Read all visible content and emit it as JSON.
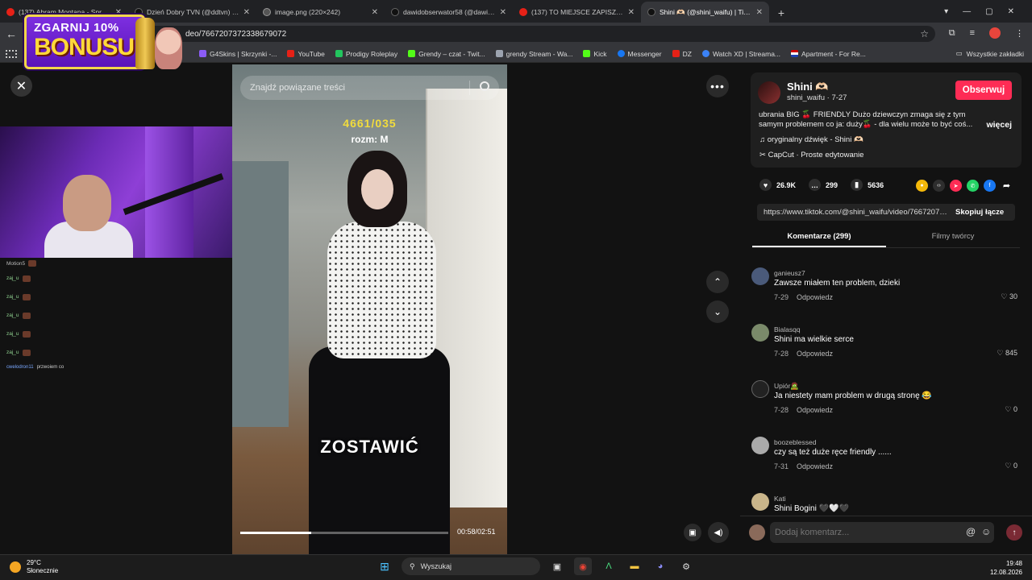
{
  "browser": {
    "tabs": [
      {
        "title": "(137) Abram Montana - Sprawi...",
        "favicon": "youtube-icon",
        "active": false
      },
      {
        "title": "Dzień Dobry TVN (@ddtvn) | Ti...",
        "favicon": "tiktok-icon",
        "active": false
      },
      {
        "title": "image.png (220×242)",
        "favicon": "globe-icon",
        "active": false
      },
      {
        "title": "dawidobserwator58 (@dawidob...",
        "favicon": "tiktok-icon",
        "active": false
      },
      {
        "title": "(137) TO MIEJSCE ZAPISZE SIĘ W...",
        "favicon": "youtube-icon",
        "active": false
      },
      {
        "title": "Shini 🫶🏻 (@shini_waifu) | TikT...",
        "favicon": "tiktok-icon",
        "active": true
      }
    ],
    "url_visible": "deo/7667207372338679072",
    "bookmarks": [
      {
        "label": "G4Skins | Skrzynki -...",
        "color": "#8b5cf6"
      },
      {
        "label": "YouTube",
        "color": "#e62117"
      },
      {
        "label": "Prodigy Roleplay",
        "color": "#22c55e"
      },
      {
        "label": "Grendy – czat - Twit...",
        "color": "#53fc18"
      },
      {
        "label": "grendy Stream - Wa...",
        "color": "#9ca3af"
      },
      {
        "label": "Kick",
        "color": "#53fc18"
      },
      {
        "label": "Messenger",
        "color": "#1877f2"
      },
      {
        "label": "DZ",
        "color": "#e62117"
      },
      {
        "label": "Watch XD | Streama...",
        "color": "#3b82f6"
      },
      {
        "label": "Apartment - For Re...",
        "color": "#1e40af"
      }
    ],
    "all_bookmarks": "Wszystkie zakładki",
    "new_tab": "+"
  },
  "overlay": {
    "bonus_line1": "ZGARNIJ 10%",
    "bonus_line2": "BONUSU",
    "chat_header": "Motion5",
    "chat_lines": [
      "zaj_u",
      "zaj_u",
      "zaj_u",
      "zaj_u",
      "zaj_u"
    ],
    "chat_last_user": "cwelodron11",
    "chat_last_text": "przwoiem co"
  },
  "video": {
    "search_placeholder": "Znajdź powiązane treści",
    "caption_count": "4661/035",
    "caption_size": "rozm: M",
    "caption_big": "ZOSTAWIĆ",
    "time": "00:58/02:51",
    "progress": 0.34
  },
  "post": {
    "author_name": "Shini 🫶🏻",
    "author_handle": "shini_waifu · 7-27",
    "follow": "Obserwuj",
    "description": "ubrania BIG 🍒 FRIENDLY Dużo dziewczyn zmaga się z tym samym problemem co ja: duży🍒 - dla wielu może to być coś...",
    "more": "więcej",
    "music": "oryginalny dźwięk - Shini 🫶🏻",
    "capcut": "CapCut · Proste edytowanie",
    "likes": "26.9K",
    "comments_count": "299",
    "saves": "5636",
    "link": "https://www.tiktok.com/@shini_waifu/video/7667207372338679072",
    "copy_link": "Skopiuj łącze",
    "tab_comments": "Komentarze (299)",
    "tab_creator": "Filmy twórcy"
  },
  "comments": [
    {
      "user": "ganieusz7",
      "text": "Zawsze miałem ten problem, dzieki",
      "date": "7-29",
      "reply": "Odpowiedz",
      "likes": "30",
      "avatar": "#4a5a7a"
    },
    {
      "user": "Bialasqq",
      "text": "Shini ma wielkie serce",
      "date": "7-28",
      "reply": "Odpowiedz",
      "likes": "845",
      "avatar": "#7a8a6a"
    },
    {
      "user": "Upiór🧟",
      "text": "Ja niestety mam problem w drugą stronę 😂",
      "date": "7-28",
      "reply": "Odpowiedz",
      "likes": "0",
      "avatar": "#222"
    },
    {
      "user": "boozeblessed",
      "text": "czy są też duże ręce friendly ......",
      "date": "7-31",
      "reply": "Odpowiedz",
      "likes": "0",
      "avatar": "#aaa"
    },
    {
      "user": "Kati",
      "text": "Shini Bogini 🖤🤍🖤",
      "date": "",
      "reply": "",
      "likes": "",
      "avatar": "#c9b58a"
    }
  ],
  "compose": {
    "placeholder": "Dodaj komentarz..."
  },
  "taskbar": {
    "temp": "29°C",
    "weather": "Słonecznie",
    "search": "Wyszukaj",
    "time": "19:48",
    "date": "12.08.2026"
  },
  "colors": {
    "accent": "#fe2c55",
    "tiktok_bg": "#121212"
  }
}
